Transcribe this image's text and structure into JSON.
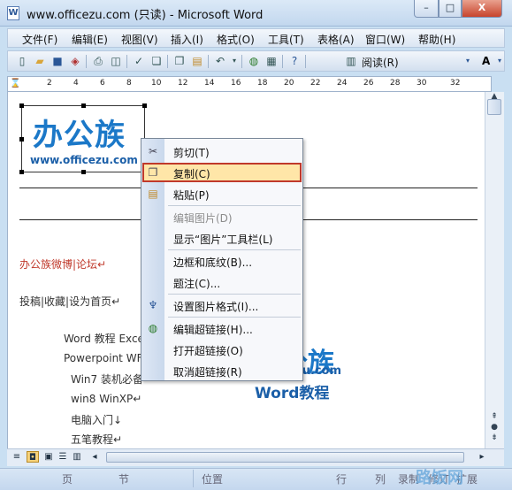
{
  "window": {
    "title": "www.officezu.com (只读) - Microsoft Word",
    "app_icon": "W",
    "min_glyph": "–",
    "max_glyph": "□",
    "close_glyph": "X"
  },
  "menubar": {
    "items": [
      "文件(F)",
      "编辑(E)",
      "视图(V)",
      "插入(I)",
      "格式(O)",
      "工具(T)",
      "表格(A)",
      "窗口(W)",
      "帮助(H)"
    ]
  },
  "toolbar": {
    "read_label": "阅读(R)",
    "font_glyph": "A",
    "icons": [
      "new-doc-icon",
      "open-folder-icon",
      "save-icon",
      "permission-icon",
      "print-icon",
      "print-preview-icon",
      "spelling-icon",
      "research-icon",
      "copy-icon",
      "paste-icon",
      "undo-icon",
      "hyperlink-icon",
      "table-icon",
      "help-icon",
      "read-mode-icon"
    ]
  },
  "ruler": {
    "numbers": [
      "2",
      "4",
      "6",
      "8",
      "10",
      "12",
      "14",
      "16",
      "18",
      "20",
      "22",
      "24",
      "26",
      "28",
      "30",
      "32"
    ]
  },
  "document": {
    "logo_text": "办公族",
    "logo_url": "www.officezu.com",
    "lines": [
      {
        "text": "办公族微博|论坛↵"
      },
      {
        "text": "投稿|收藏|设为首页↵"
      },
      {
        "text": "Word 教程 Exce"
      },
      {
        "text": "Powerpoint WF"
      },
      {
        "text": "Win7 装机必备"
      },
      {
        "text": "win8 WinXP↵"
      },
      {
        "text": "电脑入门↓"
      },
      {
        "text": "五笔教程↵"
      }
    ],
    "watermark_main": "办公族",
    "watermark_url": "Officezu.com",
    "watermark_sub": "Word教程"
  },
  "context_menu": {
    "items": [
      {
        "label": "剪切(T)",
        "icon": "scissors-icon",
        "enabled": true
      },
      {
        "label": "复制(C)",
        "icon": "copy-icon",
        "enabled": true,
        "highlighted": true
      },
      {
        "label": "粘贴(P)",
        "icon": "paste-icon",
        "enabled": true
      },
      {
        "label": "编辑图片(D)",
        "icon": "",
        "enabled": false
      },
      {
        "label": "显示“图片”工具栏(L)",
        "icon": "",
        "enabled": true
      },
      {
        "label": "边框和底纹(B)...",
        "icon": "",
        "enabled": true
      },
      {
        "label": "题注(C)...",
        "icon": "",
        "enabled": true
      },
      {
        "label": "设置图片格式(I)...",
        "icon": "format-picture-icon",
        "enabled": true
      },
      {
        "label": "编辑超链接(H)...",
        "icon": "hyperlink-icon",
        "enabled": true
      },
      {
        "label": "打开超链接(O)",
        "icon": "",
        "enabled": true
      },
      {
        "label": "取消超链接(R)",
        "icon": "",
        "enabled": true
      }
    ]
  },
  "statusbar": {
    "page": "页",
    "section": "节",
    "position": "位置",
    "line": "行",
    "column": "列",
    "rec": "录制",
    "trk": "修订",
    "ext": "扩展",
    "corner_watermark": "路饭网"
  }
}
